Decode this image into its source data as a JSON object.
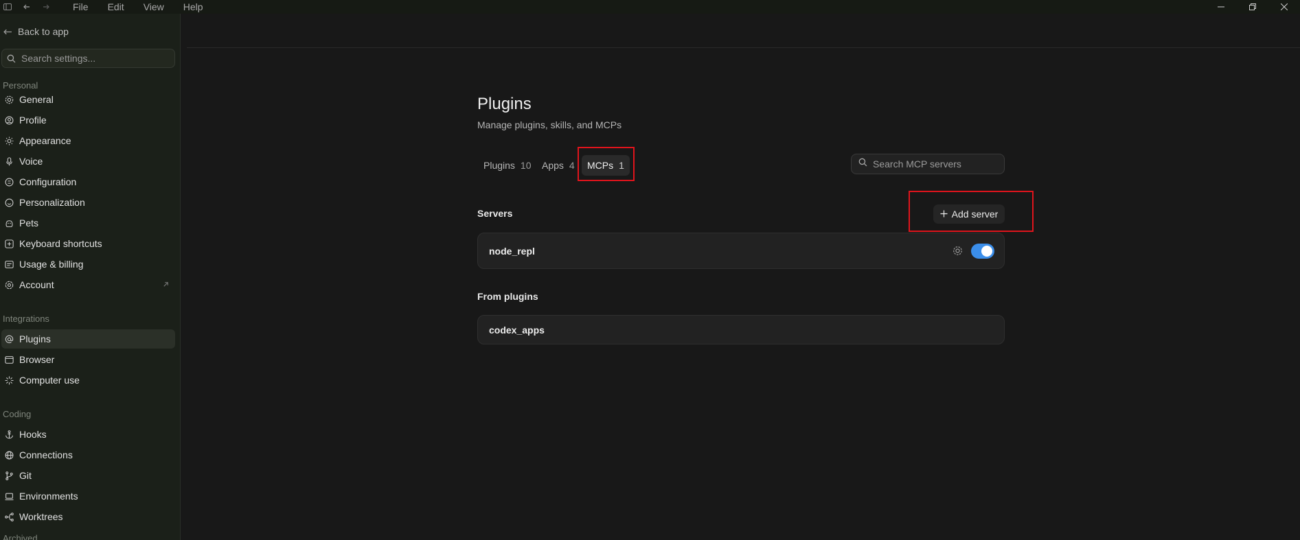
{
  "menu": [
    "File",
    "Edit",
    "View",
    "Help"
  ],
  "sidebar": {
    "back_label": "Back to app",
    "search_placeholder": "Search settings...",
    "sections": {
      "personal": "Personal",
      "integrations": "Integrations",
      "coding": "Coding",
      "archived": "Archived"
    },
    "personal_items": [
      "General",
      "Profile",
      "Appearance",
      "Voice",
      "Configuration",
      "Personalization",
      "Pets",
      "Keyboard shortcuts",
      "Usage & billing",
      "Account"
    ],
    "integration_items": [
      "Plugins",
      "Browser",
      "Computer use"
    ],
    "coding_items": [
      "Hooks",
      "Connections",
      "Git",
      "Environments",
      "Worktrees"
    ]
  },
  "main": {
    "title": "Plugins",
    "subtitle": "Manage plugins, skills, and MCPs",
    "tabs": [
      {
        "label": "Plugins",
        "count": "10"
      },
      {
        "label": "Apps",
        "count": "4"
      },
      {
        "label": "MCPs",
        "count": "1"
      }
    ],
    "active_tab": "MCPs",
    "search_placeholder": "Search MCP servers",
    "servers_heading": "Servers",
    "add_server_label": "Add server",
    "servers": [
      {
        "name": "node_repl",
        "enabled": true
      }
    ],
    "from_plugins_heading": "From plugins",
    "plugin_servers": [
      {
        "name": "codex_apps"
      }
    ]
  },
  "colors": {
    "accent": "#3b8eea",
    "highlight": "#e0141c",
    "sidebar_bg": "#1b2019",
    "main_bg": "#181818"
  }
}
